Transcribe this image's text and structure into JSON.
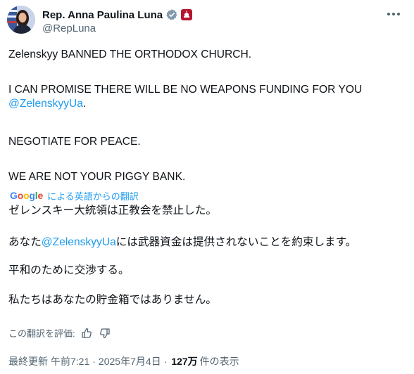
{
  "author": {
    "display_name": "Rep. Anna Paulina Luna",
    "handle": "@RepLuna"
  },
  "tweet": {
    "line1": "Zelenskyy BANNED THE ORTHODOX CHURCH.",
    "line2a": "I CAN PROMISE THERE WILL BE NO WEAPONS FUNDING FOR YOU",
    "line2_mention": "@ZelenskyyUa",
    "line2b": ".",
    "line3": "NEGOTIATE FOR PEACE.",
    "line4": "WE ARE NOT YOUR PIGGY BANK."
  },
  "translation": {
    "logo": [
      "G",
      "o",
      "o",
      "g",
      "l",
      "e"
    ],
    "label": "による英語からの翻訳",
    "line1": "ゼレンスキー大統領は正教会を禁止した。",
    "line2a": "あなた",
    "line2_mention": "@ZelenskyyUa",
    "line2b": "には武器資金は提供されないことを約束します。",
    "line3": "平和のために交渉する。",
    "line4": "私たちはあなたの貯金箱ではありません。"
  },
  "rating": {
    "label": "この翻訳を評価:"
  },
  "meta": {
    "updated_label": "最終更新",
    "time": "午前7:21",
    "date": "2025年7月4日",
    "separator": "·",
    "views_count": "127万",
    "views_label": "件の表示"
  },
  "colors": {
    "link": "#1d9bf0",
    "text": "#0f1419",
    "secondary": "#536471",
    "verified_badge": "#829aab",
    "flag_badge": "#b5172e"
  }
}
